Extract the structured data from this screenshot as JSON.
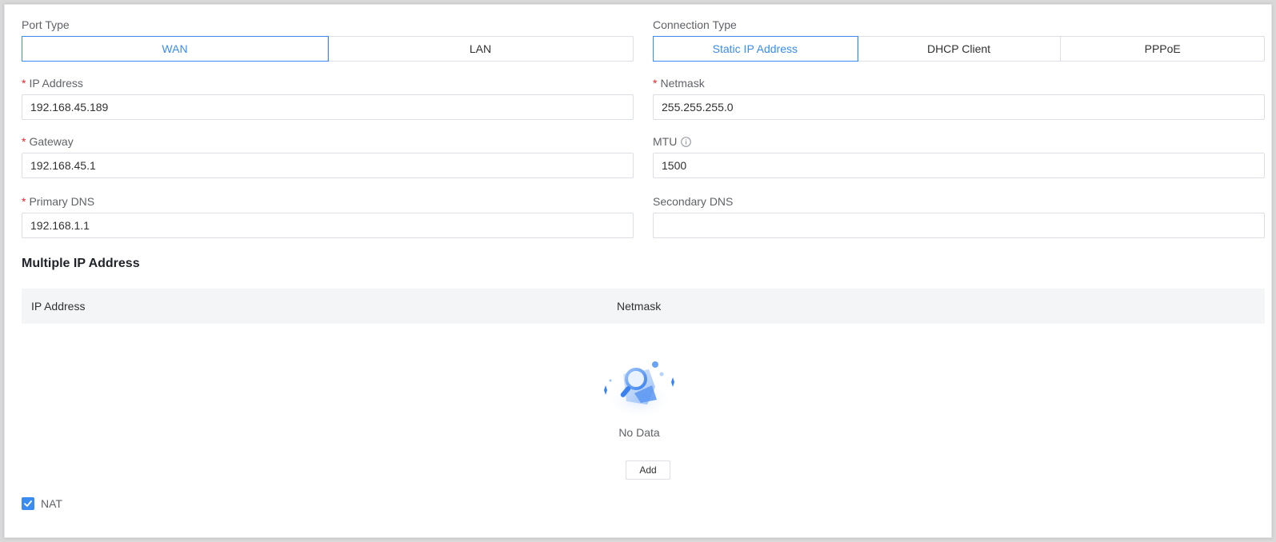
{
  "port_type": {
    "label": "Port Type",
    "options": [
      "WAN",
      "LAN"
    ],
    "selected": "WAN"
  },
  "connection_type": {
    "label": "Connection Type",
    "options": [
      "Static IP Address",
      "DHCP Client",
      "PPPoE"
    ],
    "selected": "Static IP Address"
  },
  "fields": {
    "ip_address": {
      "label": "IP Address",
      "required": true,
      "value": "192.168.45.189"
    },
    "netmask": {
      "label": "Netmask",
      "required": true,
      "value": "255.255.255.0"
    },
    "gateway": {
      "label": "Gateway",
      "required": true,
      "value": "192.168.45.1"
    },
    "mtu": {
      "label": "MTU",
      "required": false,
      "value": "1500",
      "icon": "info-icon"
    },
    "primary_dns": {
      "label": "Primary DNS",
      "required": true,
      "value": "192.168.1.1"
    },
    "secondary_dns": {
      "label": "Secondary DNS",
      "required": false,
      "value": ""
    }
  },
  "multiple_ip": {
    "title": "Multiple IP Address",
    "columns": [
      "IP Address",
      "Netmask"
    ],
    "rows": [],
    "empty_text": "No Data",
    "empty_icon": "no-data-magnifier-illustration",
    "add_label": "Add"
  },
  "nat": {
    "label": "NAT",
    "checked": true
  },
  "colors": {
    "accent": "#3b8cf0",
    "required": "#f5222d",
    "header_bg": "#f4f5f7"
  }
}
